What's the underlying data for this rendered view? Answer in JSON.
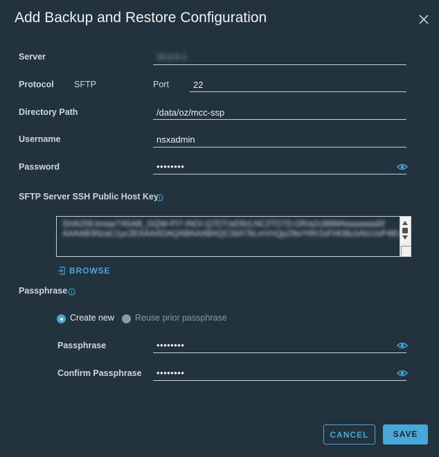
{
  "dialog": {
    "title": "Add Backup and Restore Configuration"
  },
  "form": {
    "server_label": "Server",
    "server_value": "10.0.0.1",
    "protocol_label": "Protocol",
    "protocol_value": "SFTP",
    "port_label": "Port",
    "port_value": "22",
    "directory_label": "Directory Path",
    "directory_value": "/data/oz/mcc-ssp",
    "username_label": "Username",
    "username_value": "nsxadmin",
    "password_label": "Password",
    "password_value": "••••••••",
    "hostkey_label": "SFTP Server SSH Public Host Key",
    "hostkey_value": "SHA256:tmaa/7A5AB_GQW-PI7-INO/-Q7DT/aD9zLNC2TD7D-DR/a2c88lM4aaaaaaa5f AAAAB3NzaC1yc2EAAAADAQABAAABAQC3dX7kLmVnQpZ9wYtRr2sFhK8bJxNcUoP4lEaiGvH1qBzTm0yD6fWnS5jIeK",
    "browse_label": "BROWSE",
    "passphrase_section_label": "Passphrase",
    "radio_create_label": "Create new",
    "radio_reuse_label": "Reuse prior passphrase",
    "passphrase_label": "Passphrase",
    "passphrase_value": "••••••••",
    "confirm_label": "Confirm Passphrase",
    "confirm_value": "••••••••"
  },
  "footer": {
    "cancel_label": "CANCEL",
    "save_label": "SAVE"
  },
  "icons": {
    "close": "close-icon",
    "eye": "eye-icon",
    "info": "info-icon",
    "upload": "upload-file-icon"
  },
  "colors": {
    "background": "#22333d",
    "accent": "#4aa8d8",
    "text": "#cdd6db"
  }
}
